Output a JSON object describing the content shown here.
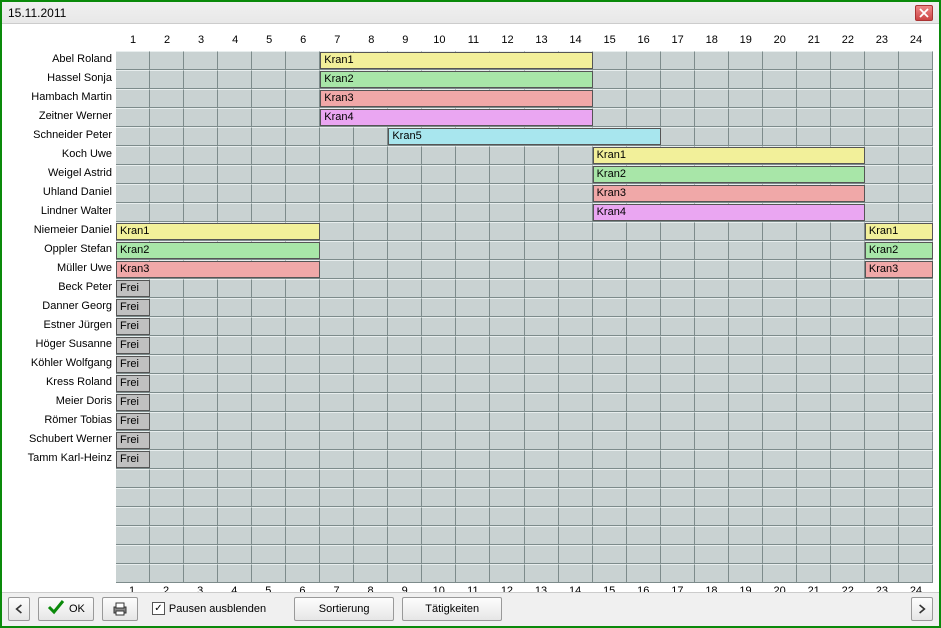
{
  "window": {
    "title": "15.11.2011"
  },
  "chart_data": {
    "type": "gantt",
    "columns": [
      "1",
      "2",
      "3",
      "4",
      "5",
      "6",
      "7",
      "8",
      "9",
      "10",
      "11",
      "12",
      "13",
      "14",
      "15",
      "16",
      "17",
      "18",
      "19",
      "20",
      "21",
      "22",
      "23",
      "24"
    ],
    "rows": [
      {
        "name": "Abel Roland",
        "bars": [
          {
            "label": "Kran1",
            "start": 6,
            "end": 14,
            "color": "#f2f09a"
          }
        ]
      },
      {
        "name": "Hassel Sonja",
        "bars": [
          {
            "label": "Kran2",
            "start": 6,
            "end": 14,
            "color": "#a8e6a8"
          }
        ]
      },
      {
        "name": "Hambach Martin",
        "bars": [
          {
            "label": "Kran3",
            "start": 6,
            "end": 14,
            "color": "#f0a8a8"
          }
        ]
      },
      {
        "name": "Zeitner Werner",
        "bars": [
          {
            "label": "Kran4",
            "start": 6,
            "end": 14,
            "color": "#eaa6f2"
          }
        ]
      },
      {
        "name": "Schneider Peter",
        "bars": [
          {
            "label": "Kran5",
            "start": 8,
            "end": 16,
            "color": "#a8e6ee"
          }
        ]
      },
      {
        "name": "Koch Uwe",
        "bars": [
          {
            "label": "Kran1",
            "start": 14,
            "end": 22,
            "color": "#f2f09a"
          }
        ]
      },
      {
        "name": "Weigel Astrid",
        "bars": [
          {
            "label": "Kran2",
            "start": 14,
            "end": 22,
            "color": "#a8e6a8"
          }
        ]
      },
      {
        "name": "Uhland Daniel",
        "bars": [
          {
            "label": "Kran3",
            "start": 14,
            "end": 22,
            "color": "#f0a8a8"
          }
        ]
      },
      {
        "name": "Lindner Walter",
        "bars": [
          {
            "label": "Kran4",
            "start": 14,
            "end": 22,
            "color": "#eaa6f2"
          }
        ]
      },
      {
        "name": "Niemeier Daniel",
        "bars": [
          {
            "label": "Kran1",
            "start": 0,
            "end": 6,
            "color": "#f2f09a"
          },
          {
            "label": "Kran1",
            "start": 22,
            "end": 24,
            "color": "#f2f09a"
          }
        ]
      },
      {
        "name": "Oppler Stefan",
        "bars": [
          {
            "label": "Kran2",
            "start": 0,
            "end": 6,
            "color": "#a8e6a8"
          },
          {
            "label": "Kran2",
            "start": 22,
            "end": 24,
            "color": "#a8e6a8"
          }
        ]
      },
      {
        "name": "Müller Uwe",
        "bars": [
          {
            "label": "Kran3",
            "start": 0,
            "end": 6,
            "color": "#f0a8a8"
          },
          {
            "label": "Kran3",
            "start": 22,
            "end": 24,
            "color": "#f0a8a8"
          }
        ]
      },
      {
        "name": "Beck Peter",
        "bars": [
          {
            "label": "Frei",
            "start": 0,
            "end": 1,
            "color": "#c0c0c0"
          }
        ]
      },
      {
        "name": "Danner Georg",
        "bars": [
          {
            "label": "Frei",
            "start": 0,
            "end": 1,
            "color": "#c0c0c0"
          }
        ]
      },
      {
        "name": "Estner Jürgen",
        "bars": [
          {
            "label": "Frei",
            "start": 0,
            "end": 1,
            "color": "#c0c0c0"
          }
        ]
      },
      {
        "name": "Höger Susanne",
        "bars": [
          {
            "label": "Frei",
            "start": 0,
            "end": 1,
            "color": "#c0c0c0"
          }
        ]
      },
      {
        "name": "Köhler Wolfgang",
        "bars": [
          {
            "label": "Frei",
            "start": 0,
            "end": 1,
            "color": "#c0c0c0"
          }
        ]
      },
      {
        "name": "Kress Roland",
        "bars": [
          {
            "label": "Frei",
            "start": 0,
            "end": 1,
            "color": "#c0c0c0"
          }
        ]
      },
      {
        "name": "Meier Doris",
        "bars": [
          {
            "label": "Frei",
            "start": 0,
            "end": 1,
            "color": "#c0c0c0"
          }
        ]
      },
      {
        "name": "Römer Tobias",
        "bars": [
          {
            "label": "Frei",
            "start": 0,
            "end": 1,
            "color": "#c0c0c0"
          }
        ]
      },
      {
        "name": "Schubert Werner",
        "bars": [
          {
            "label": "Frei",
            "start": 0,
            "end": 1,
            "color": "#c0c0c0"
          }
        ]
      },
      {
        "name": "Tamm Karl-Heinz",
        "bars": [
          {
            "label": "Frei",
            "start": 0,
            "end": 1,
            "color": "#c0c0c0"
          }
        ]
      }
    ]
  },
  "footer": {
    "ok_label": "OK",
    "pausen_label": "Pausen ausblenden",
    "sort_label": "Sortierung",
    "activities_label": "Tätigkeiten"
  }
}
